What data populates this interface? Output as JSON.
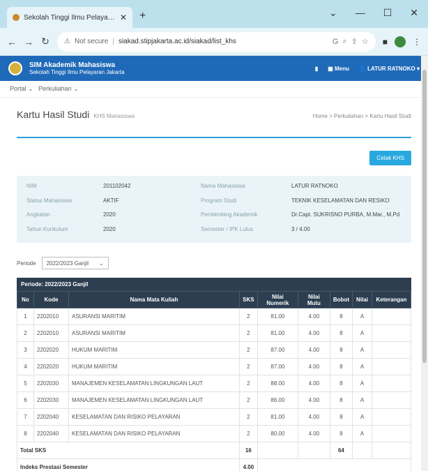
{
  "browser": {
    "tab_title": "Sekolah Tinggi Ilmu Pelayaran Ja",
    "url_security": "Not secure",
    "url": "siakad.stipjakarta.ac.id/siakad/list_khs"
  },
  "header": {
    "brand_line1": "SIM Akademik Mahasiswa",
    "brand_line2": "Sekolah Tinggi Ilmu Pelayaran Jakarta",
    "menu_label": "Menu",
    "user_label": "LATUR RATNOKO"
  },
  "breadcrumb_nav": {
    "item1": "Portal",
    "item2": "Perkuliahan"
  },
  "page": {
    "title": "Kartu Hasil Studi",
    "subtitle": "KHS Mahasiswa",
    "breadcrumb": "Home > Perkuliahan > Kartu Hasil Studi"
  },
  "actions": {
    "print_label": "Cetak KHS"
  },
  "info": [
    {
      "k1": "NIM",
      "v1": "201102042",
      "k2": "Nama Mahasiswa",
      "v2": "LATUR RATNOKO"
    },
    {
      "k1": "Status Mahasiswa",
      "v1": "AKTIF",
      "k2": "Program Studi",
      "v2": "TEKNIK KESELAMATAN DAN RESIKO"
    },
    {
      "k1": "Angkatan",
      "v1": "2020",
      "k2": "Pembimbing Akademik",
      "v2": "Dr.Capt. SUKRISNO PURBA, M.Mar., M.Pd"
    },
    {
      "k1": "Tahun Kurikulum",
      "v1": "2020",
      "k2": "Semester / IPK Lulus",
      "v2": "3 / 4.00"
    }
  ],
  "filter": {
    "label": "Periode",
    "selected": "2022/2023 Ganjil"
  },
  "table": {
    "caption": "Periode: 2022/2023 Ganjil",
    "headers": [
      "No",
      "Kode",
      "Nama Mata Kuliah",
      "SKS",
      "Nilai Numerik",
      "Nilai Mutu",
      "Bobot",
      "Nilai",
      "Keterangan"
    ],
    "rows": [
      [
        "1",
        "2202010",
        "ASURANSI MARITIM",
        "2",
        "81.00",
        "4.00",
        "8",
        "A",
        ""
      ],
      [
        "2",
        "2202010",
        "ASURANSI MARITIM",
        "2",
        "81.00",
        "4.00",
        "8",
        "A",
        ""
      ],
      [
        "3",
        "2202020",
        "HUKUM MARITIM",
        "2",
        "87.00",
        "4.00",
        "8",
        "A",
        ""
      ],
      [
        "4",
        "2202020",
        "HUKUM MARITIM",
        "2",
        "87.00",
        "4.00",
        "8",
        "A",
        ""
      ],
      [
        "5",
        "2202030",
        "MANAJEMEN KESELAMATAN LINGKUNGAN LAUT",
        "2",
        "88.00",
        "4.00",
        "8",
        "A",
        ""
      ],
      [
        "6",
        "2202030",
        "MANAJEMEN KESELAMATAN LINGKUNGAN LAUT",
        "2",
        "86.00",
        "4.00",
        "8",
        "A",
        ""
      ],
      [
        "7",
        "2202040",
        "KESELAMATAN DAN RISIKO PELAYARAN",
        "2",
        "81.00",
        "4.00",
        "8",
        "A",
        ""
      ],
      [
        "8",
        "2202040",
        "KESELAMATAN DAN RISIKO PELAYARAN",
        "2",
        "80.00",
        "4.00",
        "8",
        "A",
        ""
      ]
    ],
    "total_label": "Total SKS",
    "total_sks": "16",
    "total_bobot": "64",
    "ips_label": "Indeks Prestasi Semester",
    "ips_value": "4.00"
  }
}
